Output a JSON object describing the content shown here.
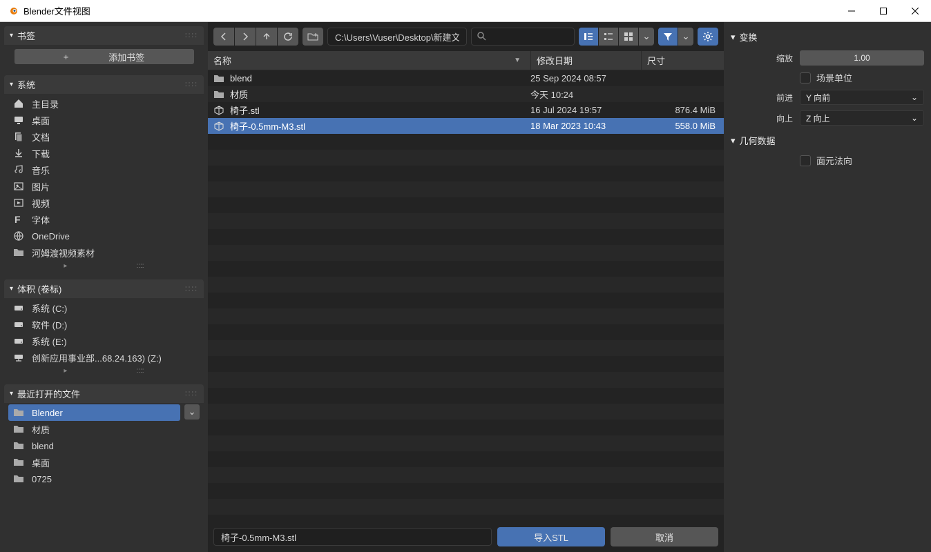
{
  "window": {
    "title": "Blender文件视图"
  },
  "bookmarks": {
    "title": "书签",
    "add_label": "添加书签"
  },
  "system": {
    "title": "系统",
    "items": [
      {
        "icon": "home",
        "label": "主目录"
      },
      {
        "icon": "desktop",
        "label": "桌面"
      },
      {
        "icon": "documents",
        "label": "文档"
      },
      {
        "icon": "download",
        "label": "下载"
      },
      {
        "icon": "music",
        "label": "音乐"
      },
      {
        "icon": "image",
        "label": "图片"
      },
      {
        "icon": "video",
        "label": "视频"
      },
      {
        "icon": "font",
        "label": "字体"
      },
      {
        "icon": "cloud",
        "label": "OneDrive"
      },
      {
        "icon": "folder",
        "label": "河姆渡视频素材"
      }
    ]
  },
  "volumes": {
    "title": "体积 (卷标)",
    "items": [
      {
        "icon": "disk",
        "label": "系统 (C:)"
      },
      {
        "icon": "disk",
        "label": "软件 (D:)"
      },
      {
        "icon": "disk",
        "label": "系统 (E:)"
      },
      {
        "icon": "network",
        "label": "创新应用事业部...68.24.163) (Z:)"
      }
    ]
  },
  "recent": {
    "title": "最近打开的文件",
    "items": [
      {
        "icon": "folder",
        "label": "Blender",
        "selected": true
      },
      {
        "icon": "folder",
        "label": "材质"
      },
      {
        "icon": "folder",
        "label": "blend"
      },
      {
        "icon": "folder",
        "label": "桌面"
      },
      {
        "icon": "folder",
        "label": "0725"
      }
    ]
  },
  "path": "C:\\Users\\Vuser\\Desktop\\新建文件夹\\Blender\\",
  "columns": {
    "name": "名称",
    "date": "修改日期",
    "size": "尺寸"
  },
  "files": [
    {
      "icon": "folder",
      "name": "blend",
      "date": "25 Sep 2024 08:57",
      "size": ""
    },
    {
      "icon": "folder",
      "name": "材质",
      "date": "今天 10:24",
      "size": ""
    },
    {
      "icon": "mesh",
      "name": "椅子.stl",
      "date": "16 Jul 2024 19:57",
      "size": "876.4 MiB"
    },
    {
      "icon": "mesh",
      "name": "椅子-0.5mm-M3.stl",
      "date": "18 Mar 2023 10:43",
      "size": "558.0 MiB",
      "selected": true
    }
  ],
  "filename": "椅子-0.5mm-M3.stl",
  "buttons": {
    "import": "导入STL",
    "cancel": "取消"
  },
  "transform": {
    "title": "变换",
    "scale_label": "缩放",
    "scale_value": "1.00",
    "scene_unit_label": "场景单位",
    "forward_label": "前进",
    "forward_value": "Y 向前",
    "up_label": "向上",
    "up_value": "Z 向上"
  },
  "geometry": {
    "title": "几何数据",
    "facet_normals_label": "面元法向"
  }
}
